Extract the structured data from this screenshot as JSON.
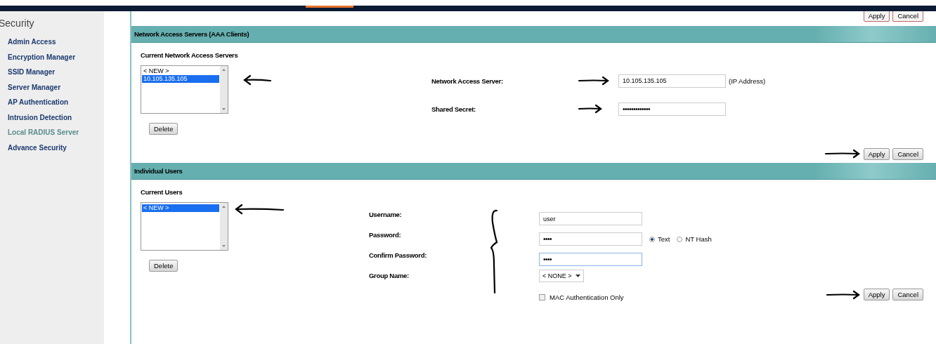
{
  "sidebar": {
    "title": "Security",
    "items": [
      {
        "label": "Admin Access",
        "selected": false
      },
      {
        "label": "Encryption Manager",
        "selected": false
      },
      {
        "label": "SSID Manager",
        "selected": false
      },
      {
        "label": "Server Manager",
        "selected": false
      },
      {
        "label": "AP Authentication",
        "selected": false
      },
      {
        "label": "Intrusion Detection",
        "selected": false
      },
      {
        "label": "Local RADIUS Server",
        "selected": true
      },
      {
        "label": "Advance Security",
        "selected": false
      }
    ]
  },
  "top_buttons": [
    "Apply",
    "Cancel"
  ],
  "nas_section": {
    "title": "Network Access Servers (AAA Clients)",
    "list_label": "Current Network Access Servers",
    "list": [
      {
        "label": "< NEW >",
        "selected": false
      },
      {
        "label": "10.105.135.105",
        "selected": true
      }
    ],
    "delete_button": "Delete",
    "fields": [
      {
        "label": "Network Access Server:",
        "value": "10.105.135.105",
        "suffix": "(IP Address)"
      },
      {
        "label": "Shared Secret:",
        "value": "•••••••••••••"
      }
    ],
    "buttons": [
      "Apply",
      "Cancel"
    ]
  },
  "users_section": {
    "title": "Individual Users",
    "list_label": "Current Users",
    "list": [
      {
        "label": "< NEW >",
        "selected": true
      }
    ],
    "delete_button": "Delete",
    "fields": [
      {
        "label": "Username:",
        "kind": "text",
        "value": "user",
        "focused": false
      },
      {
        "label": "Password:",
        "kind": "text",
        "value": "••••",
        "focused": false,
        "radios": [
          {
            "label": "Text",
            "selected": true
          },
          {
            "label": "NT Hash",
            "selected": false
          }
        ]
      },
      {
        "label": "Confirm Password:",
        "kind": "text",
        "value": "••••",
        "focused": true
      },
      {
        "label": "Group Name:",
        "kind": "select",
        "value": "< NONE >"
      }
    ],
    "checkbox": {
      "label": "MAC Authentication Only",
      "checked": false
    },
    "buttons": [
      "Apply",
      "Cancel"
    ]
  }
}
